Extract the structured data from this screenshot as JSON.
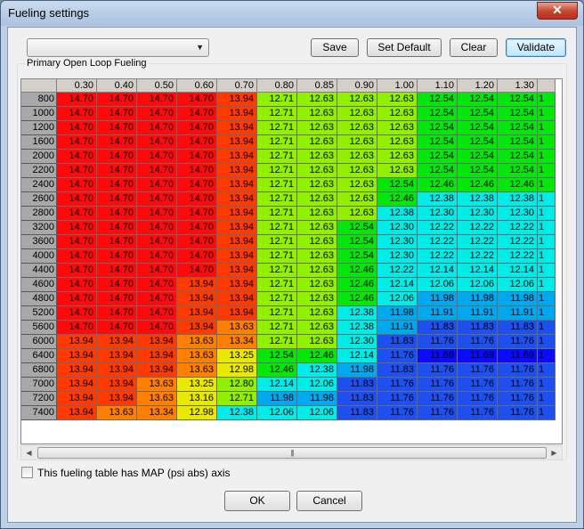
{
  "window": {
    "title": "Fueling settings",
    "close_glyph": "✕"
  },
  "toolbar": {
    "dropdown_value": "",
    "save_label": "Save",
    "set_default_label": "Set Default",
    "clear_label": "Clear",
    "validate_label": "Validate"
  },
  "table": {
    "group_label": "Primary Open Loop Fueling",
    "columns": [
      "0.30",
      "0.40",
      "0.50",
      "0.60",
      "0.70",
      "0.80",
      "0.85",
      "0.90",
      "1.00",
      "1.10",
      "1.20",
      "1.30"
    ],
    "rows": [
      "800",
      "1000",
      "1200",
      "1600",
      "2000",
      "2200",
      "2400",
      "2600",
      "2800",
      "3200",
      "3600",
      "4000",
      "4400",
      "4600",
      "4800",
      "5200",
      "5600",
      "6000",
      "6400",
      "6800",
      "7000",
      "7200",
      "7400"
    ],
    "values": [
      [
        "14.70",
        "14.70",
        "14.70",
        "14.70",
        "13.94",
        "12.71",
        "12.63",
        "12.63",
        "12.63",
        "12.54",
        "12.54",
        "12.54"
      ],
      [
        "14.70",
        "14.70",
        "14.70",
        "14.70",
        "13.94",
        "12.71",
        "12.63",
        "12.63",
        "12.63",
        "12.54",
        "12.54",
        "12.54"
      ],
      [
        "14.70",
        "14.70",
        "14.70",
        "14.70",
        "13.94",
        "12.71",
        "12.63",
        "12.63",
        "12.63",
        "12.54",
        "12.54",
        "12.54"
      ],
      [
        "14.70",
        "14.70",
        "14.70",
        "14.70",
        "13.94",
        "12.71",
        "12.63",
        "12.63",
        "12.63",
        "12.54",
        "12.54",
        "12.54"
      ],
      [
        "14.70",
        "14.70",
        "14.70",
        "14.70",
        "13.94",
        "12.71",
        "12.63",
        "12.63",
        "12.63",
        "12.54",
        "12.54",
        "12.54"
      ],
      [
        "14.70",
        "14.70",
        "14.70",
        "14.70",
        "13.94",
        "12.71",
        "12.63",
        "12.63",
        "12.63",
        "12.54",
        "12.54",
        "12.54"
      ],
      [
        "14.70",
        "14.70",
        "14.70",
        "14.70",
        "13.94",
        "12.71",
        "12.63",
        "12.63",
        "12.54",
        "12.46",
        "12.46",
        "12.46"
      ],
      [
        "14.70",
        "14.70",
        "14.70",
        "14.70",
        "13.94",
        "12.71",
        "12.63",
        "12.63",
        "12.46",
        "12.38",
        "12.38",
        "12.38"
      ],
      [
        "14.70",
        "14.70",
        "14.70",
        "14.70",
        "13.94",
        "12.71",
        "12.63",
        "12.63",
        "12.38",
        "12.30",
        "12.30",
        "12.30"
      ],
      [
        "14.70",
        "14.70",
        "14.70",
        "14.70",
        "13.94",
        "12.71",
        "12.63",
        "12.54",
        "12.30",
        "12.22",
        "12.22",
        "12.22"
      ],
      [
        "14.70",
        "14.70",
        "14.70",
        "14.70",
        "13.94",
        "12.71",
        "12.63",
        "12.54",
        "12.30",
        "12.22",
        "12.22",
        "12.22"
      ],
      [
        "14.70",
        "14.70",
        "14.70",
        "14.70",
        "13.94",
        "12.71",
        "12.63",
        "12.54",
        "12.30",
        "12.22",
        "12.22",
        "12.22"
      ],
      [
        "14.70",
        "14.70",
        "14.70",
        "14.70",
        "13.94",
        "12.71",
        "12.63",
        "12.46",
        "12.22",
        "12.14",
        "12.14",
        "12.14"
      ],
      [
        "14.70",
        "14.70",
        "14.70",
        "13.94",
        "13.94",
        "12.71",
        "12.63",
        "12.46",
        "12.14",
        "12.06",
        "12.06",
        "12.06"
      ],
      [
        "14.70",
        "14.70",
        "14.70",
        "13.94",
        "13.94",
        "12.71",
        "12.63",
        "12.46",
        "12.06",
        "11.98",
        "11.98",
        "11.98"
      ],
      [
        "14.70",
        "14.70",
        "14.70",
        "13.94",
        "13.94",
        "12.71",
        "12.63",
        "12.38",
        "11.98",
        "11.91",
        "11.91",
        "11.91"
      ],
      [
        "14.70",
        "14.70",
        "14.70",
        "13.94",
        "13.63",
        "12.71",
        "12.63",
        "12.38",
        "11.91",
        "11.83",
        "11.83",
        "11.83"
      ],
      [
        "13.94",
        "13.94",
        "13.94",
        "13.63",
        "13.34",
        "12.71",
        "12.63",
        "12.30",
        "11.83",
        "11.76",
        "11.76",
        "11.76"
      ],
      [
        "13.94",
        "13.94",
        "13.94",
        "13.63",
        "13.25",
        "12.54",
        "12.46",
        "12.14",
        "11.76",
        "11.69",
        "11.69",
        "11.69"
      ],
      [
        "13.94",
        "13.94",
        "13.94",
        "13.63",
        "12.98",
        "12.46",
        "12.38",
        "11.98",
        "11.83",
        "11.76",
        "11.76",
        "11.76"
      ],
      [
        "13.94",
        "13.94",
        "13.63",
        "13.25",
        "12.80",
        "12.14",
        "12.06",
        "11.83",
        "11.76",
        "11.76",
        "11.76",
        "11.76"
      ],
      [
        "13.94",
        "13.94",
        "13.63",
        "13.16",
        "12.71",
        "11.98",
        "11.98",
        "11.83",
        "11.76",
        "11.76",
        "11.76",
        "11.76"
      ],
      [
        "13.94",
        "13.63",
        "13.34",
        "12.98",
        "12.38",
        "12.06",
        "12.06",
        "11.83",
        "11.76",
        "11.76",
        "11.76",
        "11.76"
      ]
    ],
    "partial_column_value": "1"
  },
  "scrollbar": {
    "left_glyph": "◀",
    "right_glyph": "▶",
    "thumb_grip": "|||"
  },
  "checkbox": {
    "label": "This fueling table has MAP (psi abs) axis",
    "checked": false
  },
  "footer": {
    "ok_label": "OK",
    "cancel_label": "Cancel"
  },
  "dropdown_arrow_glyph": "▼",
  "colors": {
    "dark_blue": "#0a0aff",
    "blue": "#1e50f0",
    "light_blue": "#00a8f0",
    "cyan": "#00ece8",
    "green": "#05e60a",
    "yellow_green": "#90f000",
    "yellow": "#e8e800",
    "orange": "#ff8000",
    "red_orange": "#ff3a00",
    "red": "#ff0a0a"
  }
}
